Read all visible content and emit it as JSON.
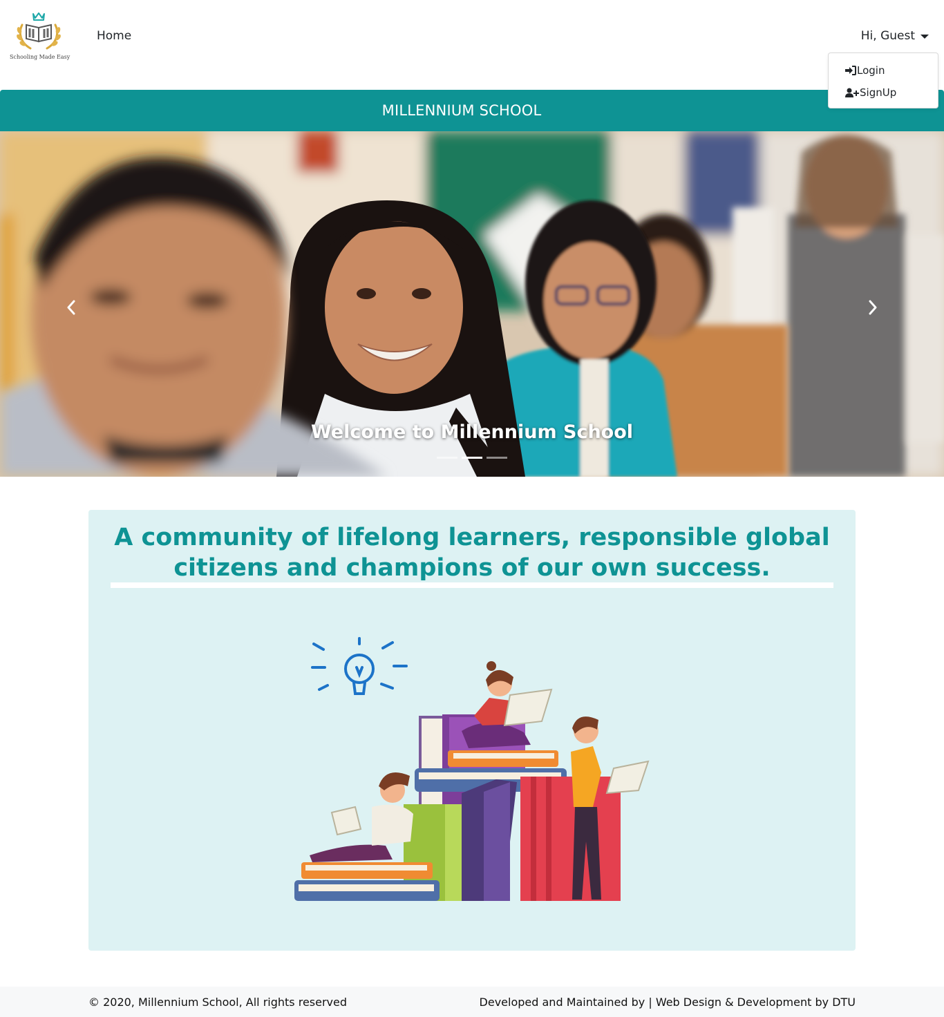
{
  "navbar": {
    "logo_caption": "Schooling Made Easy",
    "home_label": "Home",
    "user_label": "Hi, Guest"
  },
  "user_menu": {
    "items": [
      {
        "label": "Login",
        "icon": "sign-in-icon"
      },
      {
        "label": "SignUp",
        "icon": "user-plus-icon"
      }
    ]
  },
  "brand": {
    "title": "MILLENNIUM SCHOOL",
    "color": "#0e9394"
  },
  "carousel": {
    "caption": "Welcome to Millennium School",
    "prev_icon": "chevron-left-icon",
    "next_icon": "chevron-right-icon",
    "slides": 3,
    "active_slide": 2
  },
  "main": {
    "heading": "A community of lifelong learners, responsible global citizens and champions of our own success.",
    "background": "#ddf2f3"
  },
  "footer": {
    "copyright": "© 2020, Millennium School, All rights reserved",
    "credits": "Developed and Maintained by | Web Design & Development by DTU"
  }
}
